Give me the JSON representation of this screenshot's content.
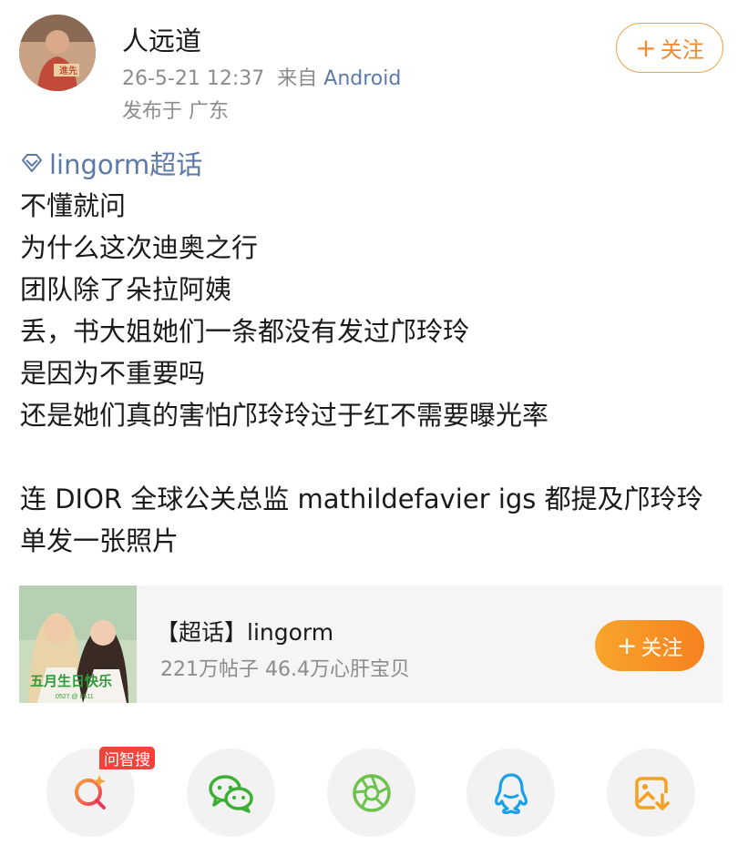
{
  "post": {
    "username": "人远道",
    "timestamp": "26-5-21 12:37",
    "source_prefix": "来自",
    "source": "Android",
    "location": "发布于 广东",
    "follow_label": "关注",
    "topic": "lingorm超话",
    "lines": [
      "不懂就问",
      "为什么这次迪奥之行",
      "团队除了朵拉阿姨",
      "丢，书大姐她们一条都没有发过邝玲玲",
      "是因为不重要吗",
      "还是她们真的害怕邝玲玲过于红不需要曝光率",
      "",
      "连 DIOR 全球公关总监 mathildefavier igs 都提及邝玲玲",
      "单发一张照片"
    ]
  },
  "card": {
    "title": "【超话】lingorm",
    "subtitle": "221万帖子 46.4万心肝宝贝",
    "follow_label": "关注",
    "image_text": "五月生日快乐",
    "image_date": "0527 @ 0511"
  },
  "share": {
    "badge": "问智搜",
    "icons": [
      "ai-search-icon",
      "wechat-icon",
      "moments-icon",
      "qq-icon",
      "save-image-icon"
    ]
  },
  "colors": {
    "accent_orange": "#f08a2c",
    "link_blue": "#5c7aa8",
    "badge_red": "#f0433a",
    "wechat_green": "#3cb034"
  }
}
